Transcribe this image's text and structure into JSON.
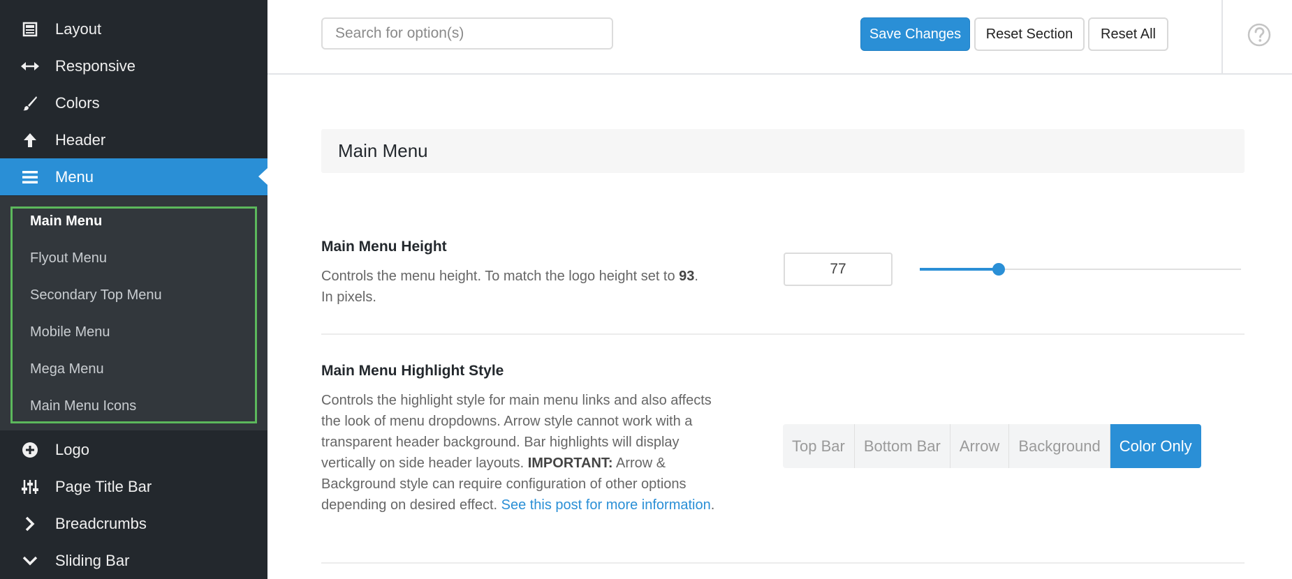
{
  "sidebar": {
    "items": [
      {
        "label": "Layout",
        "icon": "layout-icon"
      },
      {
        "label": "Responsive",
        "icon": "arrows-horizontal-icon"
      },
      {
        "label": "Colors",
        "icon": "brush-icon"
      },
      {
        "label": "Header",
        "icon": "arrow-up-icon"
      },
      {
        "label": "Menu",
        "icon": "hamburger-icon",
        "active": true
      },
      {
        "label": "Logo",
        "icon": "plus-circle-icon"
      },
      {
        "label": "Page Title Bar",
        "icon": "sliders-icon"
      },
      {
        "label": "Breadcrumbs",
        "icon": "chevron-right-icon"
      },
      {
        "label": "Sliding Bar",
        "icon": "chevron-down-icon"
      }
    ],
    "submenu": [
      {
        "label": "Main Menu",
        "current": true
      },
      {
        "label": "Flyout Menu"
      },
      {
        "label": "Secondary Top Menu"
      },
      {
        "label": "Mobile Menu"
      },
      {
        "label": "Mega Menu"
      },
      {
        "label": "Main Menu Icons"
      }
    ]
  },
  "toolbar": {
    "search_placeholder": "Search for option(s)",
    "save_label": "Save Changes",
    "reset_section_label": "Reset Section",
    "reset_all_label": "Reset All"
  },
  "section": {
    "title": "Main Menu"
  },
  "options": {
    "height": {
      "title": "Main Menu Height",
      "desc_text": "Controls the menu height. To match the logo height set to ",
      "desc_bold": "93",
      "desc_end": ".",
      "desc_line2": "In pixels.",
      "value": "77",
      "slider_fraction": 0.245
    },
    "highlight": {
      "title": "Main Menu Highlight Style",
      "desc_text": "Controls the highlight style for main menu links and also affects the look of menu dropdowns. Arrow style cannot work with a transparent header background. Bar highlights will display vertically on side header layouts. ",
      "desc_important": "IMPORTANT:",
      "desc_text2": " Arrow & Background style can require configuration of other options depending on desired effect. ",
      "desc_link": "See this post for more information",
      "desc_end": ".",
      "choices": [
        "Top Bar",
        "Bottom Bar",
        "Arrow",
        "Background",
        "Color Only"
      ],
      "selected": "Color Only"
    }
  },
  "colors": {
    "accent": "#2a8fd6",
    "sidebar_bg": "#23282d",
    "submenu_bg": "#32373c",
    "highlight_border": "#5cb85c"
  }
}
